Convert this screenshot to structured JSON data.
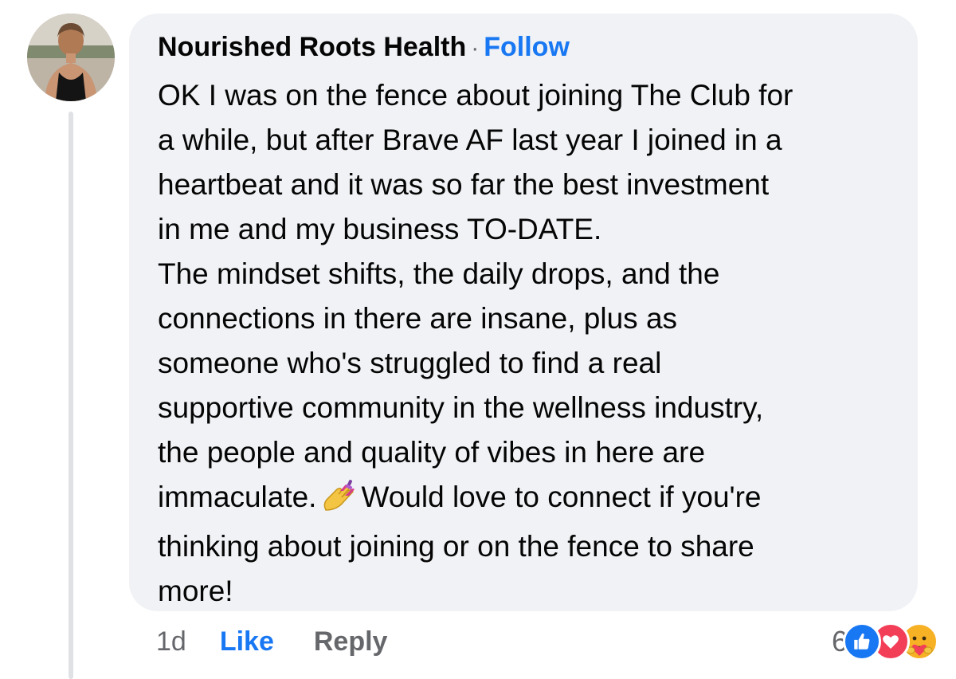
{
  "comment": {
    "author": "Nourished Roots Health",
    "separator": "·",
    "follow_label": "Follow",
    "lines": [
      "OK I was on the fence about joining The Club for",
      "a while, but after Brave AF last year I joined in a",
      "heartbeat and it was so far the best investment",
      "in me and my business TO-DATE.",
      "The mindset shifts, the daily drops, and the",
      "connections in there are insane, plus as",
      "someone who's struggled to find a real",
      "supportive community in the wellness industry,",
      "the people and quality of vibes in here are"
    ],
    "line_nails_before": "immaculate.",
    "line_nails_after": "Would love to connect if you're",
    "line_after_1": "thinking about joining or on the fence to share",
    "line_after_2": "more!",
    "emoji_icon": "nail-polish-icon"
  },
  "actions": {
    "time": "1d",
    "like_label": "Like",
    "reply_label": "Reply"
  },
  "reactions": {
    "count": "6",
    "icons": [
      "like-reaction-icon",
      "love-reaction-icon",
      "care-reaction-icon"
    ]
  },
  "colors": {
    "accent": "#1877f2",
    "bubble": "#f0f2f5",
    "secondary_text": "#65676b",
    "love": "#f33e58",
    "care": "#f7b125"
  }
}
